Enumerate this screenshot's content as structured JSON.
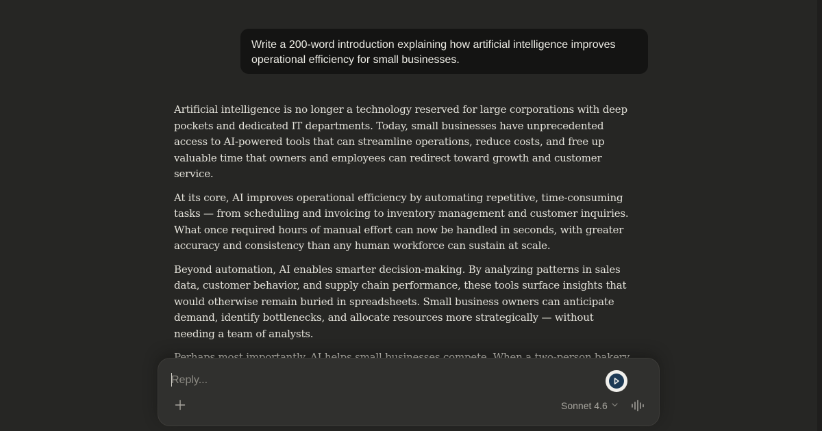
{
  "conversation": {
    "user_message": "Write a 200-word introduction explaining how artificial intelligence improves operational efficiency for small businesses.",
    "response_paragraphs": [
      "Artificial intelligence is no longer a technology reserved for large corporations with deep pockets and dedicated IT departments. Today, small businesses have unprecedented access to AI-powered tools that can streamline operations, reduce costs, and free up valuable time that owners and employees can redirect toward growth and customer service.",
      "At its core, AI improves operational efficiency by automating repetitive, time-consuming tasks — from scheduling and invoicing to inventory management and customer inquiries. What once required hours of manual effort can now be handled in seconds, with greater accuracy and consistency than any human workforce can sustain at scale.",
      "Beyond automation, AI enables smarter decision-making. By analyzing patterns in sales data, customer behavior, and supply chain performance, these tools surface insights that would otherwise remain buried in spreadsheets. Small business owners can anticipate demand, identify bottlenecks, and allocate resources more strategically — without needing a team of analysts.",
      "Perhaps most importantly, AI helps small businesses compete. When a two-person bakery can manage customer communications with the same responsiveness as a national chain, or"
    ]
  },
  "composer": {
    "placeholder": "Reply...",
    "model_label": "Sonnet 4.6",
    "icons": {
      "add": "plus-icon",
      "model": "chevron-down-icon",
      "voice": "voice-waveform-icon",
      "extension": "extension-icon"
    }
  },
  "colors": {
    "background": "#262624",
    "user_bubble": "#141413",
    "composer": "#30302e",
    "text": "#e3e1d9",
    "muted": "#a8a69f",
    "extension_accent": "#1d3a55"
  }
}
